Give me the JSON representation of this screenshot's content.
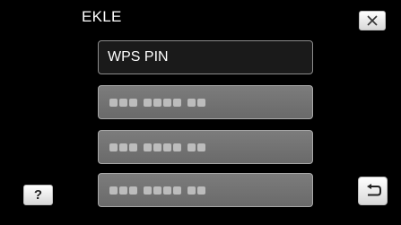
{
  "screen": {
    "title": "EKLE"
  },
  "menu": {
    "items": [
      {
        "label": "WPS PIN",
        "state": "selected"
      },
      {
        "label": "",
        "state": "placeholder",
        "pattern": "blurred-dots"
      },
      {
        "label": "",
        "state": "placeholder",
        "pattern": "blurred-dots"
      },
      {
        "label": "",
        "state": "placeholder",
        "pattern": "blurred-dots"
      }
    ]
  },
  "buttons": {
    "help_label": "?",
    "close_icon": "close-icon",
    "back_icon": "return-icon"
  },
  "colors": {
    "background": "#000000",
    "selected_item_bg": "#1a1a1a",
    "placeholder_item_bg": "#737373",
    "button_face": "#e8e8e8"
  }
}
